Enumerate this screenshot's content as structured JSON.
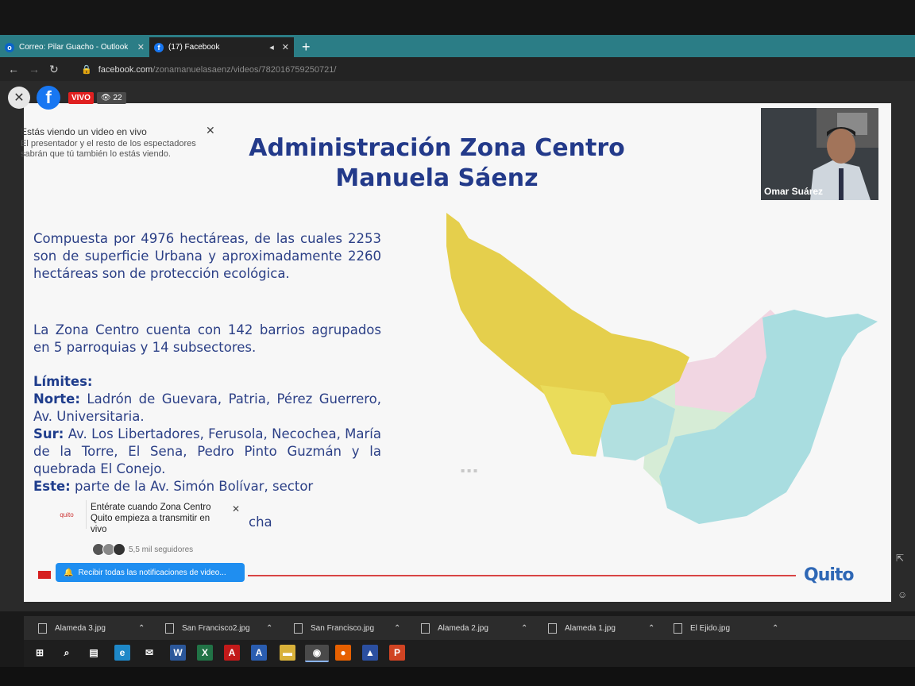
{
  "browser": {
    "tabs": [
      {
        "label": "Correo: Pilar Guacho - Outlook",
        "icon": "outlook-icon"
      },
      {
        "label": "(17) Facebook",
        "icon": "facebook-icon"
      }
    ],
    "url_host": "facebook.com",
    "url_path": "/zonamanuelasaenz/videos/782016759250721/"
  },
  "live": {
    "badge": "VIVO",
    "viewers": "22",
    "notice_title": "Estás viendo un video en vivo",
    "notice_body": "El presentador y el resto de los espectadores sabrán que tú también lo estás viendo."
  },
  "slide": {
    "title_line1": "Administración Zona Centro",
    "title_line2": "Manuela Sáenz",
    "para1": "Compuesta por 4976 hectáreas, de las cuales 2253 son de superficie Urbana y aproximadamente 2260 hectáreas son de protección ecológica.",
    "para2": "La Zona Centro cuenta con 142 barrios agrupados en 5 parroquias y 14 subsectores.",
    "limits_label": "Límites:",
    "norte_label": "Norte:",
    "norte_text": " Ladrón de Guevara, Patria, Pérez Guerrero, Av. Universitaria.",
    "sur_label": "Sur:",
    "sur_text": " Av. Los Libertadores, Ferusola, Necochea, María de la Torre, El Sena, Pedro Pinto Guzmán y la quebrada El Conejo.",
    "este_label": "Este:",
    "este_text": " parte de la Av. Simón Bolívar, sector",
    "tail": "cha",
    "logo": "Quito",
    "map_colors": {
      "yellow": "#e5cf4c",
      "cyan": "#a9dde0",
      "pink": "#f1d3e0",
      "green": "#cfe9cf"
    }
  },
  "presenter": {
    "name": "Omar Suárez"
  },
  "follow_card": {
    "text": "Entérate cuando Zona Centro Quito empieza a transmitir en vivo",
    "followers": "5,5 mil seguidores",
    "button": "Recibir todas las notificaciones de video..."
  },
  "downloads": [
    {
      "name": "Alameda 3.jpg"
    },
    {
      "name": "San Francisco2.jpg"
    },
    {
      "name": "San Francisco.jpg"
    },
    {
      "name": "Alameda 2.jpg"
    },
    {
      "name": "Alameda 1.jpg"
    },
    {
      "name": "El Ejido.jpg"
    }
  ],
  "taskbar_apps": [
    {
      "name": "windows-start-icon",
      "color": "#3a3a3a",
      "glyph": ""
    },
    {
      "name": "search-icon",
      "color": "#3a3a3a",
      "glyph": "⌕"
    },
    {
      "name": "task-view-icon",
      "color": "#3a3a3a",
      "glyph": "▤"
    },
    {
      "name": "edge-icon",
      "color": "#1e88c8",
      "glyph": "e"
    },
    {
      "name": "mail-icon",
      "color": "#3a3a3a",
      "glyph": "✉"
    },
    {
      "name": "word-icon",
      "color": "#2b579a",
      "glyph": "W"
    },
    {
      "name": "excel-icon",
      "color": "#217346",
      "glyph": "X"
    },
    {
      "name": "acrobat-icon",
      "color": "#c21a1a",
      "glyph": "A"
    },
    {
      "name": "app-icon",
      "color": "#2a5db0",
      "glyph": "A"
    },
    {
      "name": "files-icon",
      "color": "#d8b13a",
      "glyph": "▬"
    },
    {
      "name": "chrome-icon",
      "color": "#4a4a4a",
      "glyph": "◉"
    },
    {
      "name": "firefox-icon",
      "color": "#e66000",
      "glyph": "●"
    },
    {
      "name": "photos-icon",
      "color": "#2b4fa0",
      "glyph": "▲"
    },
    {
      "name": "powerpoint-icon",
      "color": "#d04423",
      "glyph": "P"
    }
  ]
}
